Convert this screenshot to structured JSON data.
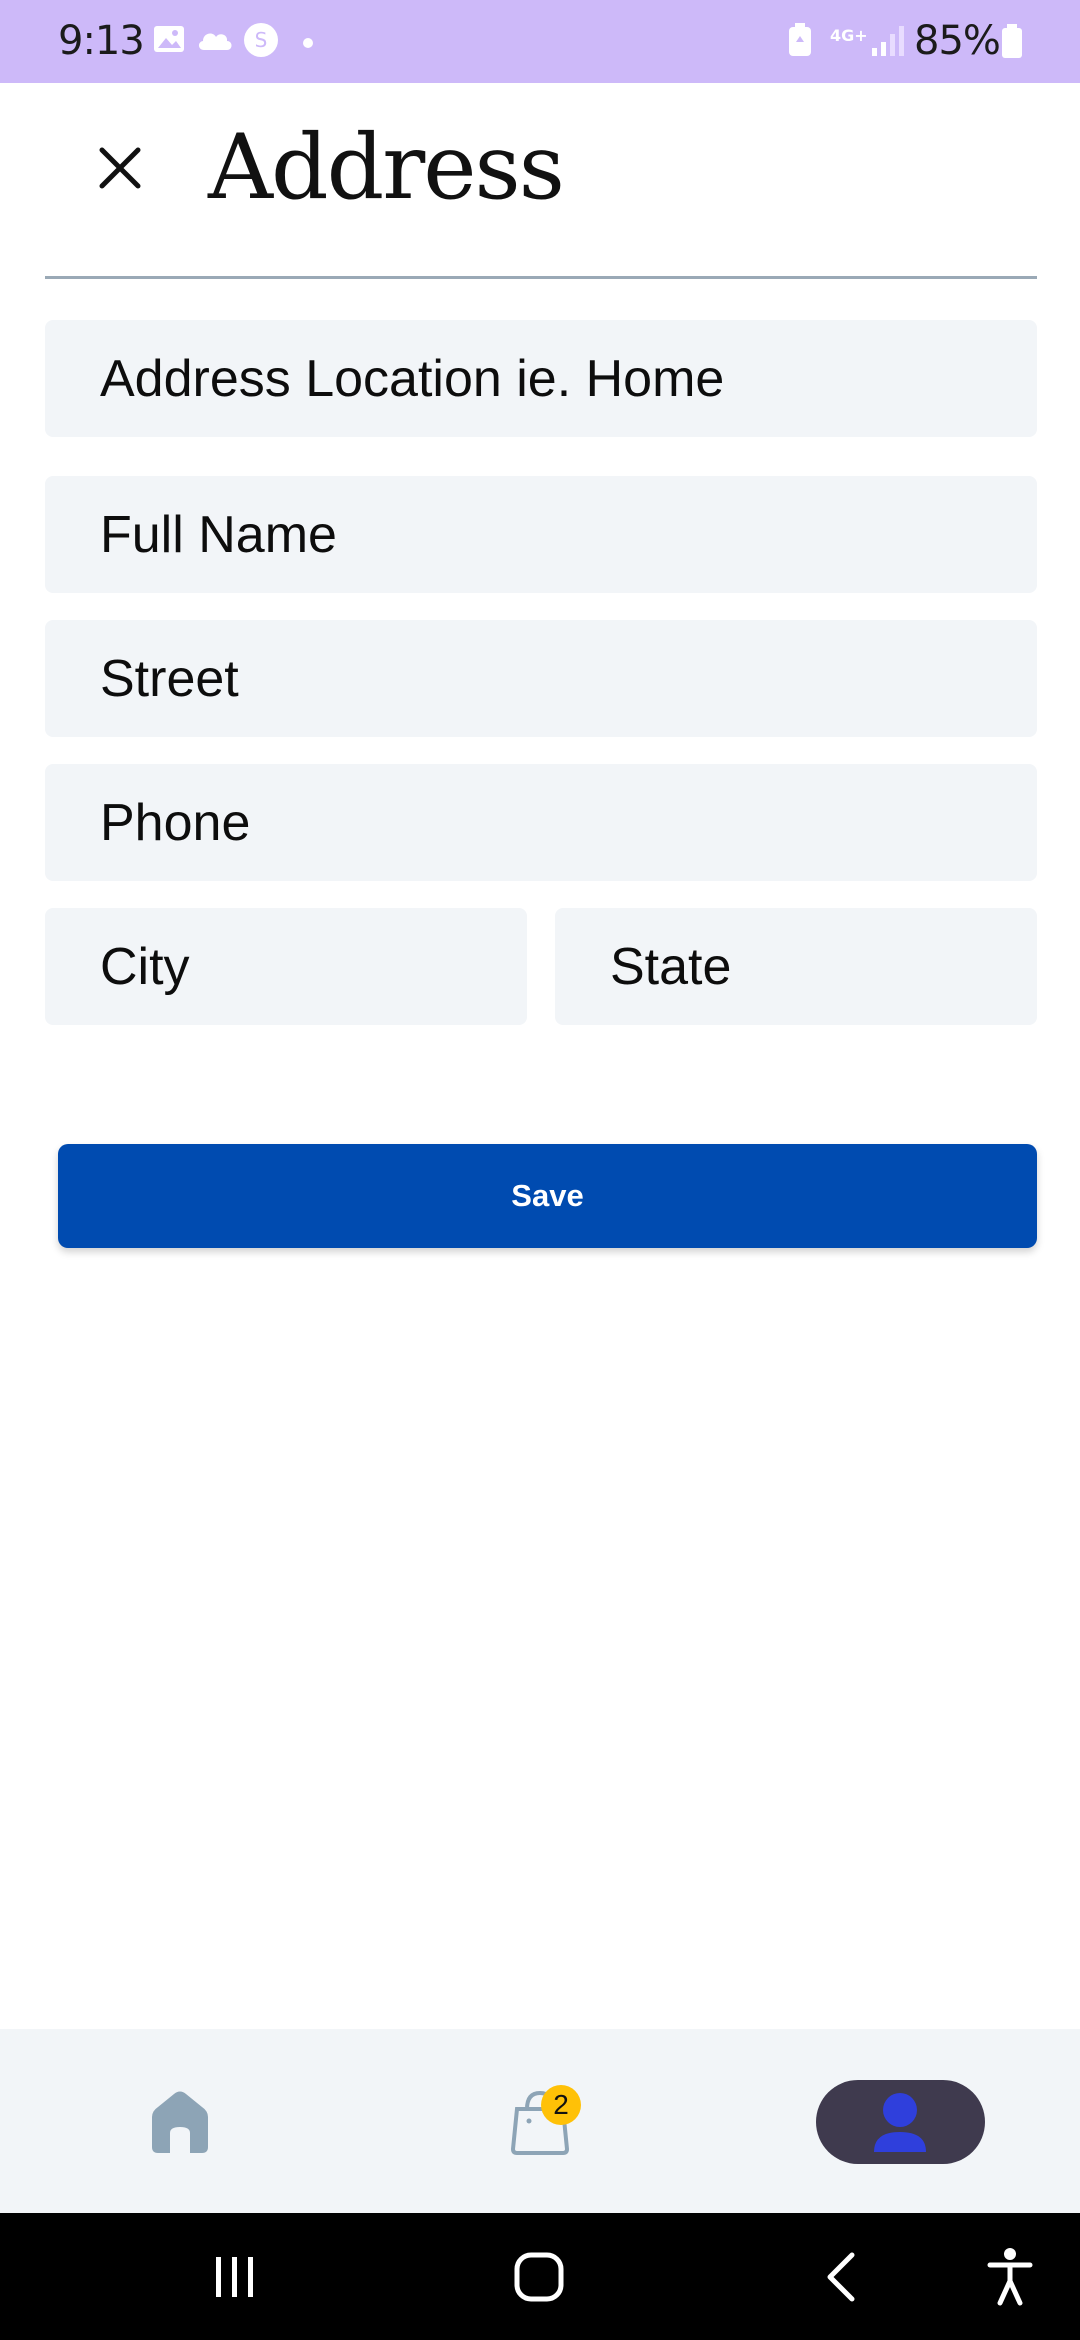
{
  "status_bar": {
    "time": "9:13",
    "network": "4G+",
    "battery": "85%",
    "background": "#cdb9f9"
  },
  "header": {
    "title": "Address",
    "close_icon": "close-icon"
  },
  "form": {
    "address_location": {
      "value": "",
      "placeholder": "Address Location ie. Home"
    },
    "full_name": {
      "value": "",
      "placeholder": "Full Name"
    },
    "street": {
      "value": "",
      "placeholder": "Street"
    },
    "phone": {
      "value": "",
      "placeholder": "Phone"
    },
    "city": {
      "value": "",
      "placeholder": "City"
    },
    "state": {
      "value": "",
      "placeholder": "State"
    },
    "save_label": "Save",
    "accent": "#004bb0"
  },
  "bottom_nav": {
    "items": [
      {
        "icon": "home-icon"
      },
      {
        "icon": "shopping-bag-icon",
        "badge": "2"
      },
      {
        "icon": "profile-icon",
        "active": true
      }
    ],
    "badge_color": "#ffc107"
  },
  "system_nav": {
    "items": [
      "recent-apps-icon",
      "home-button-icon",
      "back-icon",
      "accessibility-icon"
    ]
  }
}
